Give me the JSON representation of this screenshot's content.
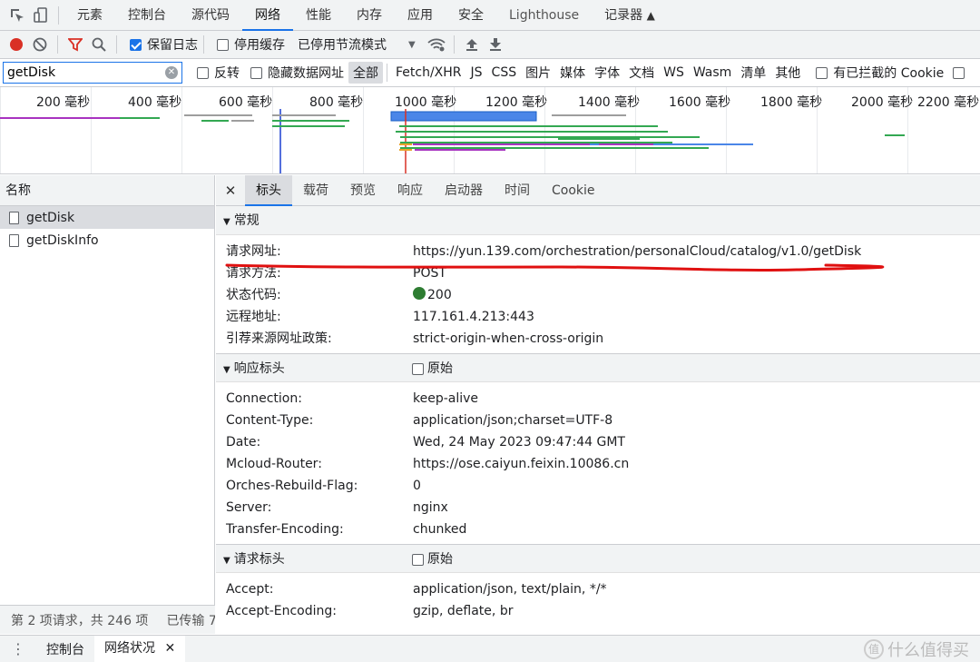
{
  "tabs": [
    {
      "label": "元素"
    },
    {
      "label": "控制台"
    },
    {
      "label": "源代码"
    },
    {
      "label": "网络"
    },
    {
      "label": "性能"
    },
    {
      "label": "内存"
    },
    {
      "label": "应用"
    },
    {
      "label": "安全"
    },
    {
      "label": "Lighthouse"
    },
    {
      "label": "记录器"
    }
  ],
  "toolbar": {
    "preserve_log": "保留日志",
    "disable_cache": "停用缓存",
    "throttle": "已停用节流模式"
  },
  "filter": {
    "value": "getDisk",
    "invert": "反转",
    "hide_data_urls": "隐藏数据网址",
    "types": [
      "全部",
      "Fetch/XHR",
      "JS",
      "CSS",
      "图片",
      "媒体",
      "字体",
      "文档",
      "WS",
      "Wasm",
      "清单",
      "其他"
    ],
    "blocked_cookies": "有已拦截的 Cookie"
  },
  "timeline": {
    "ticks": [
      "200 毫秒",
      "400 毫秒",
      "600 毫秒",
      "800 毫秒",
      "1000 毫秒",
      "1200 毫秒",
      "1400 毫秒",
      "1600 毫秒",
      "1800 毫秒",
      "2000 毫秒",
      "2200 毫秒"
    ]
  },
  "requests": {
    "header": "名称",
    "items": [
      {
        "name": "getDisk"
      },
      {
        "name": "getDiskInfo"
      }
    ],
    "status": "第 2 项请求，共 246 项",
    "transferred": "已传输 7"
  },
  "detail": {
    "tabs": [
      "标头",
      "载荷",
      "预览",
      "响应",
      "启动器",
      "时间",
      "Cookie"
    ],
    "general": {
      "title": "常规",
      "rows": [
        {
          "k": "请求网址:",
          "v": "https://yun.139.com/orchestration/personalCloud/catalog/v1.0/getDisk"
        },
        {
          "k": "请求方法:",
          "v": "POST"
        },
        {
          "k": "状态代码:",
          "v": "200"
        },
        {
          "k": "远程地址:",
          "v": "117.161.4.213:443"
        },
        {
          "k": "引荐来源网址政策:",
          "v": "strict-origin-when-cross-origin"
        }
      ]
    },
    "response_headers": {
      "title": "响应标头",
      "raw": "原始",
      "rows": [
        {
          "k": "Connection:",
          "v": "keep-alive"
        },
        {
          "k": "Content-Type:",
          "v": "application/json;charset=UTF-8"
        },
        {
          "k": "Date:",
          "v": "Wed, 24 May 2023 09:47:44 GMT"
        },
        {
          "k": "Mcloud-Router:",
          "v": "https://ose.caiyun.feixin.10086.cn"
        },
        {
          "k": "Orches-Rebuild-Flag:",
          "v": "0"
        },
        {
          "k": "Server:",
          "v": "nginx"
        },
        {
          "k": "Transfer-Encoding:",
          "v": "chunked"
        }
      ]
    },
    "request_headers": {
      "title": "请求标头",
      "raw": "原始",
      "rows": [
        {
          "k": "Accept:",
          "v": "application/json, text/plain, */*"
        },
        {
          "k": "Accept-Encoding:",
          "v": "gzip, deflate, br"
        }
      ]
    }
  },
  "drawer": {
    "console": "控制台",
    "network_conditions": "网络状况"
  },
  "watermark": "什么值得买",
  "colors": {
    "accent": "#1a73e8",
    "annotation": "#e01010",
    "status_ok": "#2e7d32"
  }
}
